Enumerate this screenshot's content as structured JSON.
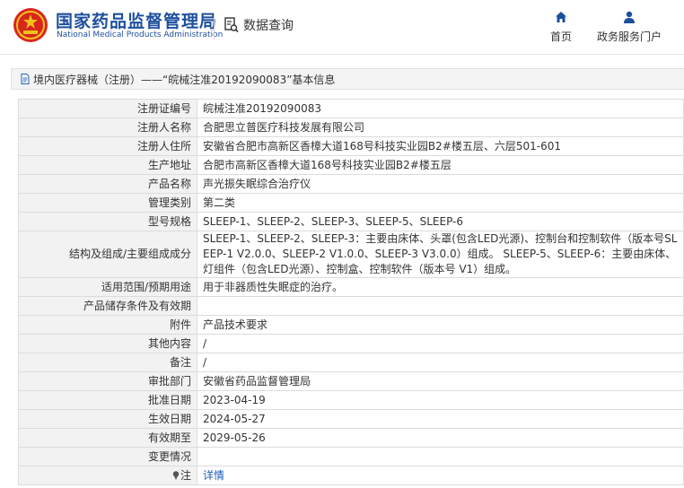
{
  "header": {
    "org_name_cn": "国家药品监督管理局",
    "org_name_en": "National Medical Products Administration",
    "query_label": "数据查询",
    "nav": [
      {
        "label": "首页",
        "icon": "home-icon"
      },
      {
        "label": "政务服务门户",
        "icon": "user-icon"
      }
    ],
    "colors": {
      "brand": "#1d4f9d",
      "emblem_red": "#d7261e",
      "emblem_gold": "#f3c21a"
    }
  },
  "title_bar": {
    "text": "境内医疗器械（注册）——“皖械注准20192090083”基本信息"
  },
  "detail_rows": [
    {
      "label": "注册证编号",
      "value": "皖械注准20192090083"
    },
    {
      "label": "注册人名称",
      "value": "合肥思立普医疗科技发展有限公司"
    },
    {
      "label": "注册人住所",
      "value": "安徽省合肥市高新区香樟大道168号科技实业园B2#楼五层、六层501-601"
    },
    {
      "label": "生产地址",
      "value": "合肥市高新区香樟大道168号科技实业园B2#楼五层"
    },
    {
      "label": "产品名称",
      "value": "声光振失眠综合治疗仪"
    },
    {
      "label": "管理类别",
      "value": "第二类"
    },
    {
      "label": "型号规格",
      "value": "SLEEP-1、SLEEP-2、SLEEP-3、SLEEP-5、SLEEP-6"
    },
    {
      "label": "结构及组成/主要组成成分",
      "value": "SLEEP-1、SLEEP-2、SLEEP-3：主要由床体、头罩(包含LED光源)、控制台和控制软件（版本号SLEEP-1 V2.0.0、SLEEP-2 V1.0.0、SLEEP-3 V3.0.0）组成。 SLEEP-5、SLEEP-6：主要由床体、灯组件（包含LED光源）、控制盒、控制软件（版本号 V1）组成。"
    },
    {
      "label": "适用范围/预期用途",
      "value": "用于非器质性失眠症的治疗。"
    },
    {
      "label": "产品储存条件及有效期",
      "value": ""
    },
    {
      "label": "附件",
      "value": "产品技术要求"
    },
    {
      "label": "其他内容",
      "value": "/"
    },
    {
      "label": "备注",
      "value": "/"
    },
    {
      "label": "审批部门",
      "value": "安徽省药品监督管理局"
    },
    {
      "label": "批准日期",
      "value": "2023-04-19"
    },
    {
      "label": "生效日期",
      "value": "2024-05-27"
    },
    {
      "label": "有效期至",
      "value": "2029-05-26"
    },
    {
      "label": "变更情况",
      "value": ""
    }
  ],
  "note_row": {
    "label": "注",
    "link_text": "详情",
    "icon": "pin-icon"
  }
}
